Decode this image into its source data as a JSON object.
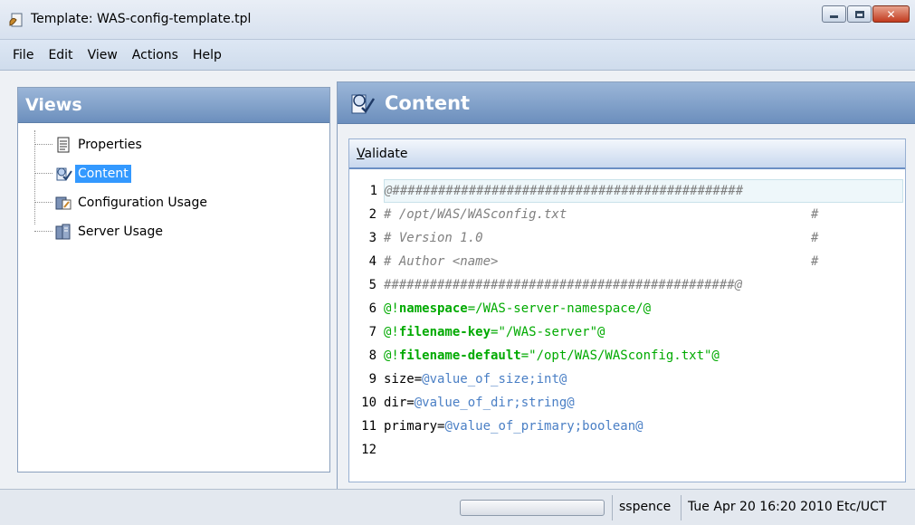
{
  "window": {
    "title": "Template: WAS-config-template.tpl",
    "icon": "template-icon"
  },
  "menu": [
    "File",
    "Edit",
    "View",
    "Actions",
    "Help"
  ],
  "views_panel": {
    "header": "Views",
    "items": [
      {
        "label": "Properties",
        "icon": "properties-icon",
        "selected": false
      },
      {
        "label": "Content",
        "icon": "content-icon",
        "selected": true
      },
      {
        "label": "Configuration Usage",
        "icon": "configuration-usage-icon",
        "selected": false
      },
      {
        "label": "Server Usage",
        "icon": "server-usage-icon",
        "selected": false
      }
    ]
  },
  "content_panel": {
    "header": "Content",
    "validate_label_first": "V",
    "validate_label_rest": "alidate",
    "lines": [
      {
        "n": "1",
        "text": "@##############################################",
        "style": "comment"
      },
      {
        "n": "2",
        "text": "# /opt/WAS/WASconfig.txt",
        "trail": "#",
        "style": "comment"
      },
      {
        "n": "3",
        "text": "# Version 1.0",
        "trail": "#",
        "style": "comment"
      },
      {
        "n": "4",
        "text": "# Author <name>",
        "trail": "#",
        "style": "comment"
      },
      {
        "n": "5",
        "text": "##############################################@",
        "style": "comment"
      },
      {
        "n": "6",
        "prefix": "@!",
        "key": "namespace",
        "rest": "=/WAS-server-namespace/@",
        "style": "directive"
      },
      {
        "n": "7",
        "prefix": "@!",
        "key": "filename-key",
        "rest": "=\"/WAS-server\"@",
        "style": "directive"
      },
      {
        "n": "8",
        "prefix": "@!",
        "key": "filename-default",
        "rest": "=\"/opt/WAS/WASconfig.txt\"@",
        "style": "directive"
      },
      {
        "n": "9",
        "name": "size=",
        "value": "@value_of_size;int@",
        "style": "assign"
      },
      {
        "n": "10",
        "name": "dir=",
        "value": "@value_of_dir;string@",
        "style": "assign"
      },
      {
        "n": "11",
        "name": "primary=",
        "value": "@value_of_primary;boolean@",
        "style": "assign"
      },
      {
        "n": "12",
        "text": "",
        "style": "plain"
      }
    ]
  },
  "status": {
    "user": "sspence",
    "datetime": "Tue Apr 20 16:20 2010 Etc/UCT"
  },
  "colors": {
    "comment": "#808080",
    "directive": "#00aa00",
    "value": "#4a7fc5",
    "selection": "#3399ff",
    "panel_header": "#7b9bc6"
  }
}
